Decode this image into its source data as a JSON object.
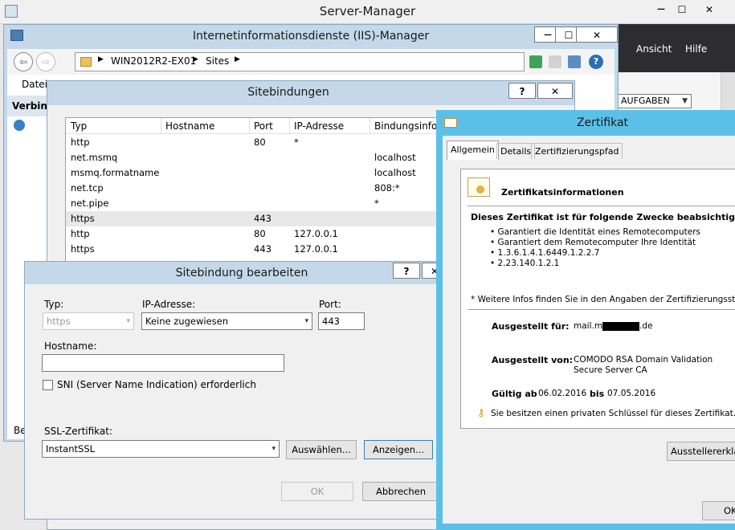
{
  "server_manager": {
    "title": "Server-Manager",
    "menu": [
      "Ansicht",
      "Hilfe"
    ],
    "tasks_label": "AUFGABEN"
  },
  "iis": {
    "title": "Internetinformationsdienste (IIS)-Manager",
    "breadcrumb": [
      "WIN2012R2-EX01",
      "Sites"
    ],
    "menu_file": "Datei",
    "connections_label": "Verbin",
    "status_fragment": "Be"
  },
  "site_bindings": {
    "title": "Sitebindungen",
    "help_label": "?",
    "columns": [
      "Typ",
      "Hostname",
      "Port",
      "IP-Adresse",
      "Bindungsinform"
    ],
    "rows": [
      {
        "type": "http",
        "host": "",
        "port": "80",
        "ip": "*",
        "info": ""
      },
      {
        "type": "net.msmq",
        "host": "",
        "port": "",
        "ip": "",
        "info": "localhost"
      },
      {
        "type": "msmq.formatname",
        "host": "",
        "port": "",
        "ip": "",
        "info": "localhost"
      },
      {
        "type": "net.tcp",
        "host": "",
        "port": "",
        "ip": "",
        "info": "808:*"
      },
      {
        "type": "net.pipe",
        "host": "",
        "port": "",
        "ip": "",
        "info": "*"
      },
      {
        "type": "https",
        "host": "",
        "port": "443",
        "ip": "",
        "info": ""
      },
      {
        "type": "http",
        "host": "",
        "port": "80",
        "ip": "127.0.0.1",
        "info": ""
      },
      {
        "type": "https",
        "host": "",
        "port": "443",
        "ip": "127.0.0.1",
        "info": ""
      }
    ]
  },
  "edit_binding": {
    "title": "Sitebindung bearbeiten",
    "help_label": "?",
    "type_label": "Typ:",
    "type_value": "https",
    "ip_label": "IP-Adresse:",
    "ip_value": "Keine zugewiesen",
    "port_label": "Port:",
    "port_value": "443",
    "hostname_label": "Hostname:",
    "hostname_value": "",
    "sni_label": "SNI (Server Name Indication) erforderlich",
    "ssl_label": "SSL-Zertifikat:",
    "ssl_value": "InstantSSL",
    "select_button": "Auswählen...",
    "view_button": "Anzeigen...",
    "ok_button": "OK",
    "cancel_button": "Abbrechen"
  },
  "certificate": {
    "title": "Zertifikat",
    "tabs": [
      "Allgemein",
      "Details",
      "Zertifizierungspfad"
    ],
    "info_heading": "Zertifikatsinformationen",
    "purpose_heading": "Dieses Zertifikat ist für folgende Zwecke beabsichtigt:",
    "purposes": [
      "Garantiert die Identität eines Remotecomputers",
      "Garantiert dem Remotecomputer Ihre Identität",
      "1.3.6.1.4.1.6449.1.2.2.7",
      "2.23.140.1.2.1"
    ],
    "more_info": "* Weitere Infos finden Sie in den Angaben der Zertifizierungsstelle.",
    "issued_to_label": "Ausgestellt für:",
    "issued_to_prefix": "mail.m",
    "issued_to_suffix": ".de",
    "issued_by_label": "Ausgestellt von:",
    "issued_by_value": "COMODO RSA Domain Validation Secure Server CA",
    "valid_from_label": "Gültig ab",
    "valid_from": "06.02.2016",
    "valid_to_label": "bis",
    "valid_to": "07.05.2016",
    "private_key_note": "Sie besitzen einen privaten Schlüssel für dieses Zertifikat.",
    "issuer_statement_button": "Ausstellererkläru",
    "ok_button": "OK",
    "accent_color": "#5bc0e8"
  },
  "window_controls": {
    "minimize": "—",
    "maximize": "☐",
    "close": "✕"
  }
}
